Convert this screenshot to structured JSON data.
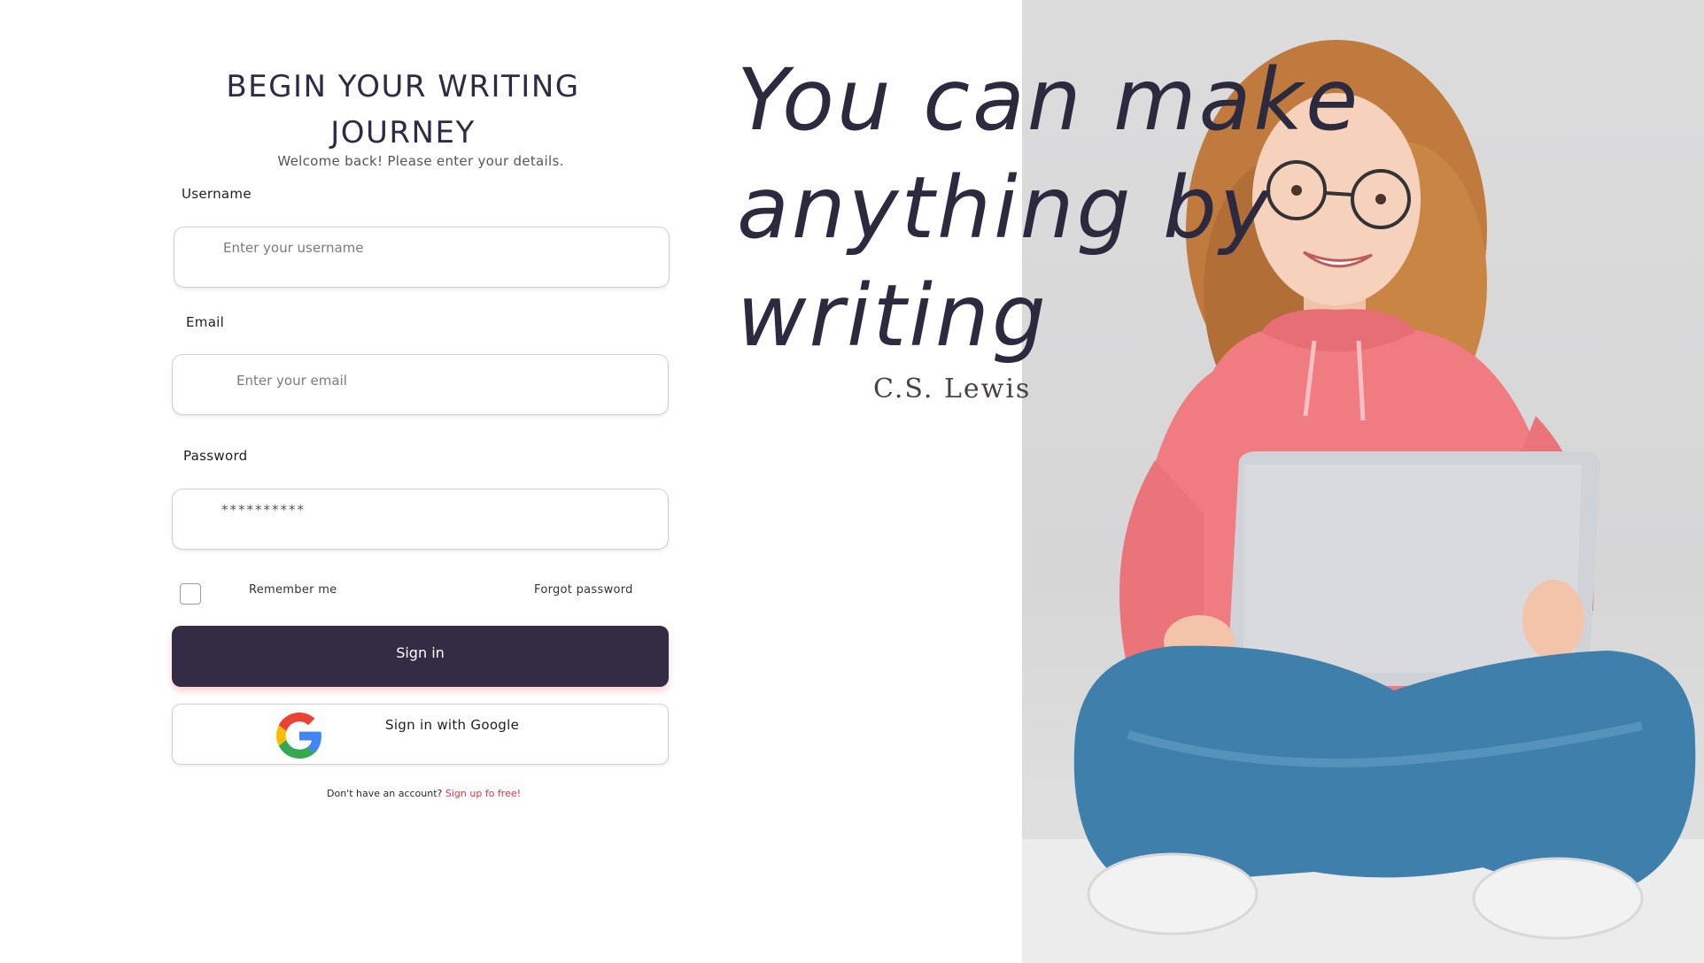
{
  "form": {
    "title": "BEGIN YOUR WRITING JOURNEY",
    "subtitle": "Welcome back! Please enter your details.",
    "username_label": "Username",
    "username_placeholder": "Enter your username",
    "email_label": "Email",
    "email_placeholder": "Enter your email",
    "password_label": "Password",
    "password_value": "**********",
    "remember_label": "Remember me",
    "forgot_label": "Forgot password",
    "signin_label": "Sign in",
    "google_label": "Sign in with Google",
    "signup_prompt": "Don't have an account?",
    "signup_link": "Sign up fo free!"
  },
  "quote": {
    "text": "You can make anything by writing",
    "author": "C.S. Lewis"
  },
  "colors": {
    "primary": "#322c45",
    "link": "#e0353d",
    "hoodie": "#f07c82",
    "jeans": "#3f7fab"
  },
  "icons": {
    "google": "google-logo-icon"
  }
}
